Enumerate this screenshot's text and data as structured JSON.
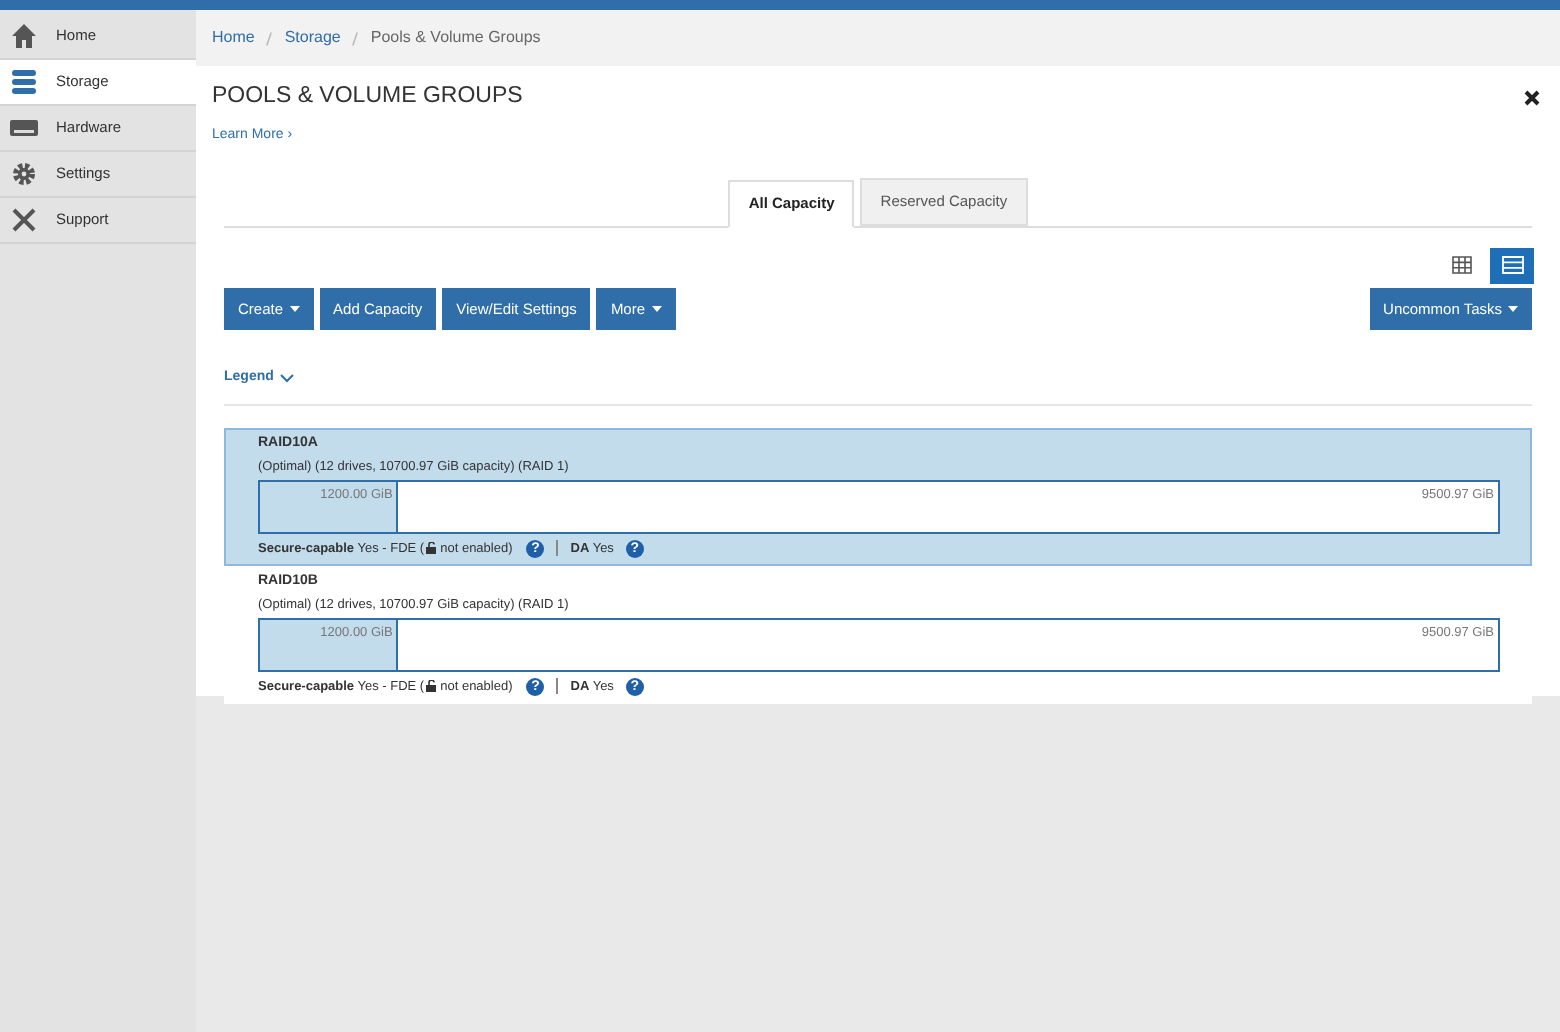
{
  "sidebar": {
    "items": [
      {
        "label": "Home",
        "kind": "home",
        "selected": false
      },
      {
        "label": "Storage",
        "kind": "storage",
        "selected": true
      },
      {
        "label": "Hardware",
        "kind": "hardware",
        "selected": false
      },
      {
        "label": "Settings",
        "kind": "settings",
        "selected": false
      },
      {
        "label": "Support",
        "kind": "support",
        "selected": false
      }
    ]
  },
  "breadcrumb": [
    {
      "label": "Home",
      "link": true
    },
    {
      "label": "Storage",
      "link": true
    },
    {
      "label": "Pools & Volume Groups",
      "link": false
    }
  ],
  "page": {
    "title": "POOLS & VOLUME GROUPS",
    "learn_more": "Learn More ›"
  },
  "tabs": [
    {
      "label": "All Capacity",
      "selected": true
    },
    {
      "label": "Reserved Capacity",
      "selected": false
    }
  ],
  "view_toggles": [
    {
      "kind": "grid",
      "selected": false
    },
    {
      "kind": "list",
      "selected": true
    }
  ],
  "toolbar": {
    "buttons": [
      {
        "label": "Create",
        "dropdown": true
      },
      {
        "label": "Add Capacity",
        "dropdown": false
      },
      {
        "label": "View/Edit Settings",
        "dropdown": false
      },
      {
        "label": "More",
        "dropdown": true
      }
    ],
    "right_button": {
      "label": "Uncommon Tasks",
      "dropdown": true
    }
  },
  "legend": "Legend",
  "pools": [
    {
      "name": "RAID10A",
      "description": "(Optimal) (12 drives, 10700.97 GiB capacity) (RAID 1)",
      "used": "1200.00 GiB",
      "free": "9500.97 GiB",
      "level": 0.112,
      "selected": true,
      "secure_before": "**Secure-capable** Yes - FDE (",
      "secure_after": "not enabled)",
      "secure_help": "?",
      "da": "**DA** Yes",
      "da_help": "?"
    },
    {
      "name": "RAID10B",
      "description": "(Optimal) (12 drives, 10700.97 GiB capacity) (RAID 1)",
      "used": "1200.00 GiB",
      "free": "9500.97 GiB",
      "level": 0.112,
      "selected": false,
      "secure_before": "**Secure-capable** Yes - FDE (",
      "secure_after": "not enabled)",
      "secure_help": "?",
      "da": "**DA** Yes",
      "da_help": "?"
    }
  ]
}
